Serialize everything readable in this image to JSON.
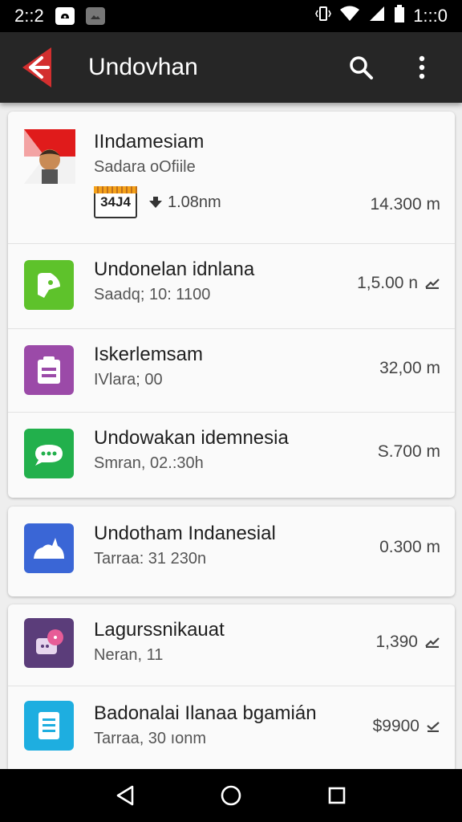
{
  "status_bar": {
    "time": "2::2",
    "clock": "1:::0"
  },
  "app_bar": {
    "title": "Undovhan"
  },
  "cards": [
    {
      "items": [
        {
          "title": "IIndamesiam",
          "subtitle": "Sadara oOfiile",
          "tag": "34J4",
          "meta": "1.08nm",
          "value": "14.300 m",
          "icon": "flag-avatar-icon"
        },
        {
          "title": "Undonelan idnlana",
          "subtitle": "Saadq; 10: 1100",
          "value": "1,5.00 n",
          "icon": "green-app-icon",
          "color": "#5ec22b"
        },
        {
          "title": "Iskerlemsam",
          "subtitle": "IVlara; 00",
          "value": "32,00 m",
          "icon": "purple-app-icon",
          "color": "#9b4aa8"
        },
        {
          "title": "Undowakan idemnesia",
          "subtitle": "Smran, 02.:30h",
          "value": "S.700 m",
          "icon": "chat-app-icon",
          "color": "#22b04c"
        }
      ]
    },
    {
      "items": [
        {
          "title": "Undotham Indanesial",
          "subtitle": "Tarraa: 31 230n",
          "value": "0.300 m",
          "icon": "blue-app-icon",
          "color": "#3a66d6"
        }
      ]
    },
    {
      "items": [
        {
          "title": "Lagurssnikauat",
          "subtitle": "Neran, 11",
          "value": "1,390",
          "icon": "message-app-icon",
          "color": "#5b3d7a"
        },
        {
          "title": "Badonalai Ilanaa bgamián",
          "subtitle": "Tarraa, 30 ıonm",
          "value": "$9900",
          "icon": "docs-app-icon",
          "color": "#1eaee0"
        }
      ]
    }
  ]
}
